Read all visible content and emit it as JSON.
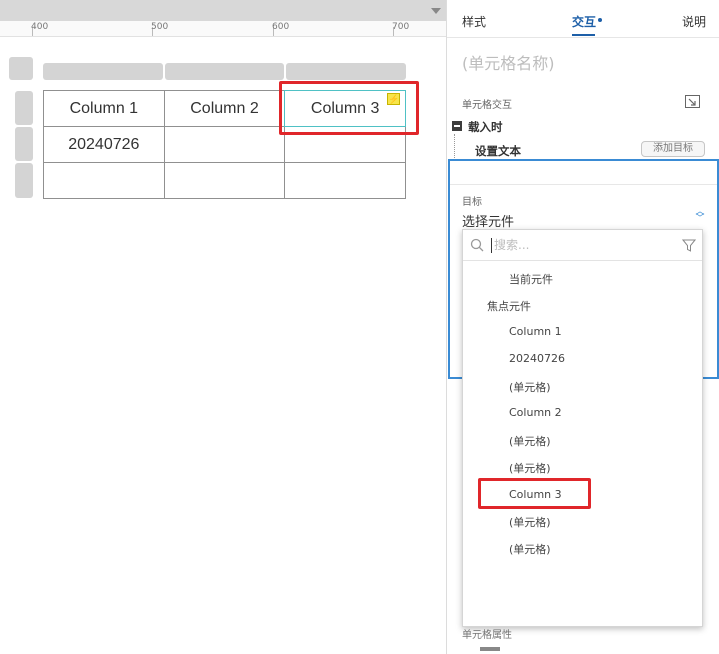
{
  "ruler": {
    "labels": [
      "400",
      "500",
      "600",
      "700"
    ]
  },
  "table": {
    "rows": [
      [
        "Column 1",
        "Column 2",
        "Column 3"
      ],
      [
        "20240726",
        "",
        ""
      ],
      [
        "",
        "",
        ""
      ]
    ]
  },
  "tabs": {
    "style": "样式",
    "interact": "交互",
    "notes": "说明"
  },
  "panel": {
    "cell_name_placeholder": "(单元格名称)",
    "section_title": "单元格交互",
    "event": "载入时",
    "action": "设置文本",
    "add_target": "添加目标",
    "target_label": "目标",
    "target_select": "选择元件",
    "bottom_label": "单元格属性"
  },
  "dropdown": {
    "search_placeholder": "搜索...",
    "items": [
      {
        "label": "当前元件",
        "level": 2
      },
      {
        "label": "焦点元件",
        "level": 1
      },
      {
        "label": "Column 1",
        "level": 2
      },
      {
        "label": "20240726",
        "level": 2
      },
      {
        "label": "(单元格)",
        "level": 2
      },
      {
        "label": "Column 2",
        "level": 2
      },
      {
        "label": "(单元格)",
        "level": 2
      },
      {
        "label": "(单元格)",
        "level": 2
      },
      {
        "label": "Column 3",
        "level": 2
      },
      {
        "label": "(单元格)",
        "level": 2
      },
      {
        "label": "(单元格)",
        "level": 2
      }
    ]
  },
  "colors": {
    "accent": "#1d5fa8",
    "selection_red": "#e0262a",
    "focus_blue": "#3a8bd4",
    "cell_selected_outline": "#4fc1c5",
    "interaction_badge": "#f7e54a"
  },
  "icons": {
    "interaction_badge": "lightning-icon",
    "search": "search-icon",
    "filter": "filter-icon",
    "corner": "expand-corner-icon",
    "collapse": "collapse-minus-icon",
    "select": "chevron-updown-icon"
  }
}
